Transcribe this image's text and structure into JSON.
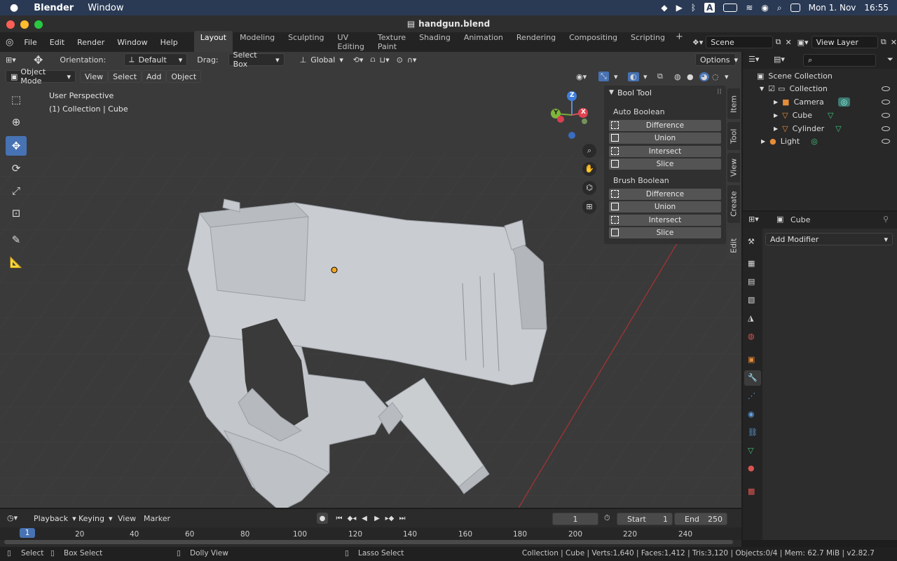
{
  "macmenu": {
    "app": "Blender",
    "window": "Window",
    "date": "Mon 1. Nov",
    "time": "16:55",
    "a_badge": "A"
  },
  "title": "handgun.blend",
  "topmenu": [
    "File",
    "Edit",
    "Render",
    "Window",
    "Help"
  ],
  "workspaces": [
    "Layout",
    "Modeling",
    "Sculpting",
    "UV Editing",
    "Texture Paint",
    "Shading",
    "Animation",
    "Rendering",
    "Compositing",
    "Scripting"
  ],
  "scene": "Scene",
  "view_layer": "View Layer",
  "add_tab": "+",
  "tool_header": {
    "orientation_label": "Orientation:",
    "orientation": "Default",
    "drag_label": "Drag:",
    "drag": "Select Box",
    "transform": "Global",
    "options": "Options"
  },
  "view_header": {
    "mode": "Object Mode",
    "view": "View",
    "select": "Select",
    "add": "Add",
    "object": "Object"
  },
  "viewport": {
    "perspective": "User Perspective",
    "collection": "(1) Collection | Cube",
    "axis_x": "X",
    "axis_y": "Y",
    "axis_z": "Z"
  },
  "boolpanel": {
    "title": "Bool Tool",
    "auto": "Auto Boolean",
    "brush": "Brush Boolean",
    "buttons": [
      "Difference",
      "Union",
      "Intersect",
      "Slice"
    ]
  },
  "sidetabs": [
    "Item",
    "Tool",
    "View",
    "Create",
    "Edit"
  ],
  "outliner": {
    "root": "Scene Collection",
    "collection": "Collection",
    "items": [
      "Camera",
      "Cube",
      "Cylinder",
      "Light"
    ]
  },
  "properties": {
    "object": "Cube",
    "add_modifier": "Add Modifier"
  },
  "timeline": {
    "playback": "Playback",
    "keying": "Keying",
    "view": "View",
    "marker": "Marker",
    "current": "1",
    "start_label": "Start",
    "start": "1",
    "end_label": "End",
    "end": "250",
    "ticks": [
      "1",
      "20",
      "40",
      "60",
      "80",
      "100",
      "120",
      "140",
      "160",
      "180",
      "200",
      "220",
      "240"
    ]
  },
  "status": {
    "select": "Select",
    "box_select": "Box Select",
    "dolly": "Dolly View",
    "lasso": "Lasso Select",
    "info": "Collection | Cube | Verts:1,640 | Faces:1,412 | Tris:3,120 | Objects:0/4 | Mem: 62.7 MiB | v2.82.7"
  }
}
